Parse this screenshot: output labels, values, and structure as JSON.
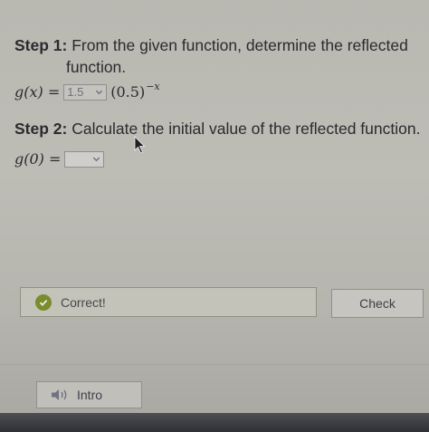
{
  "step1": {
    "label": "Step 1:",
    "text_line1": "From the given function, determine the reflected",
    "text_line2": "function."
  },
  "equation1": {
    "lhs": "g(x) =",
    "dropdown_value": "1.5",
    "base": "(0.5)",
    "exponent": "−x"
  },
  "step2": {
    "label": "Step 2:",
    "text": "Calculate the initial value of the reflected function."
  },
  "equation2": {
    "lhs": "g(0) =",
    "dropdown_value": ""
  },
  "feedback": {
    "text": "Correct!"
  },
  "buttons": {
    "check_label": "Check",
    "intro_label": "Intro"
  },
  "colors": {
    "correct_icon": "#7a8c2e",
    "panel_bg": "#bdbcb5"
  }
}
